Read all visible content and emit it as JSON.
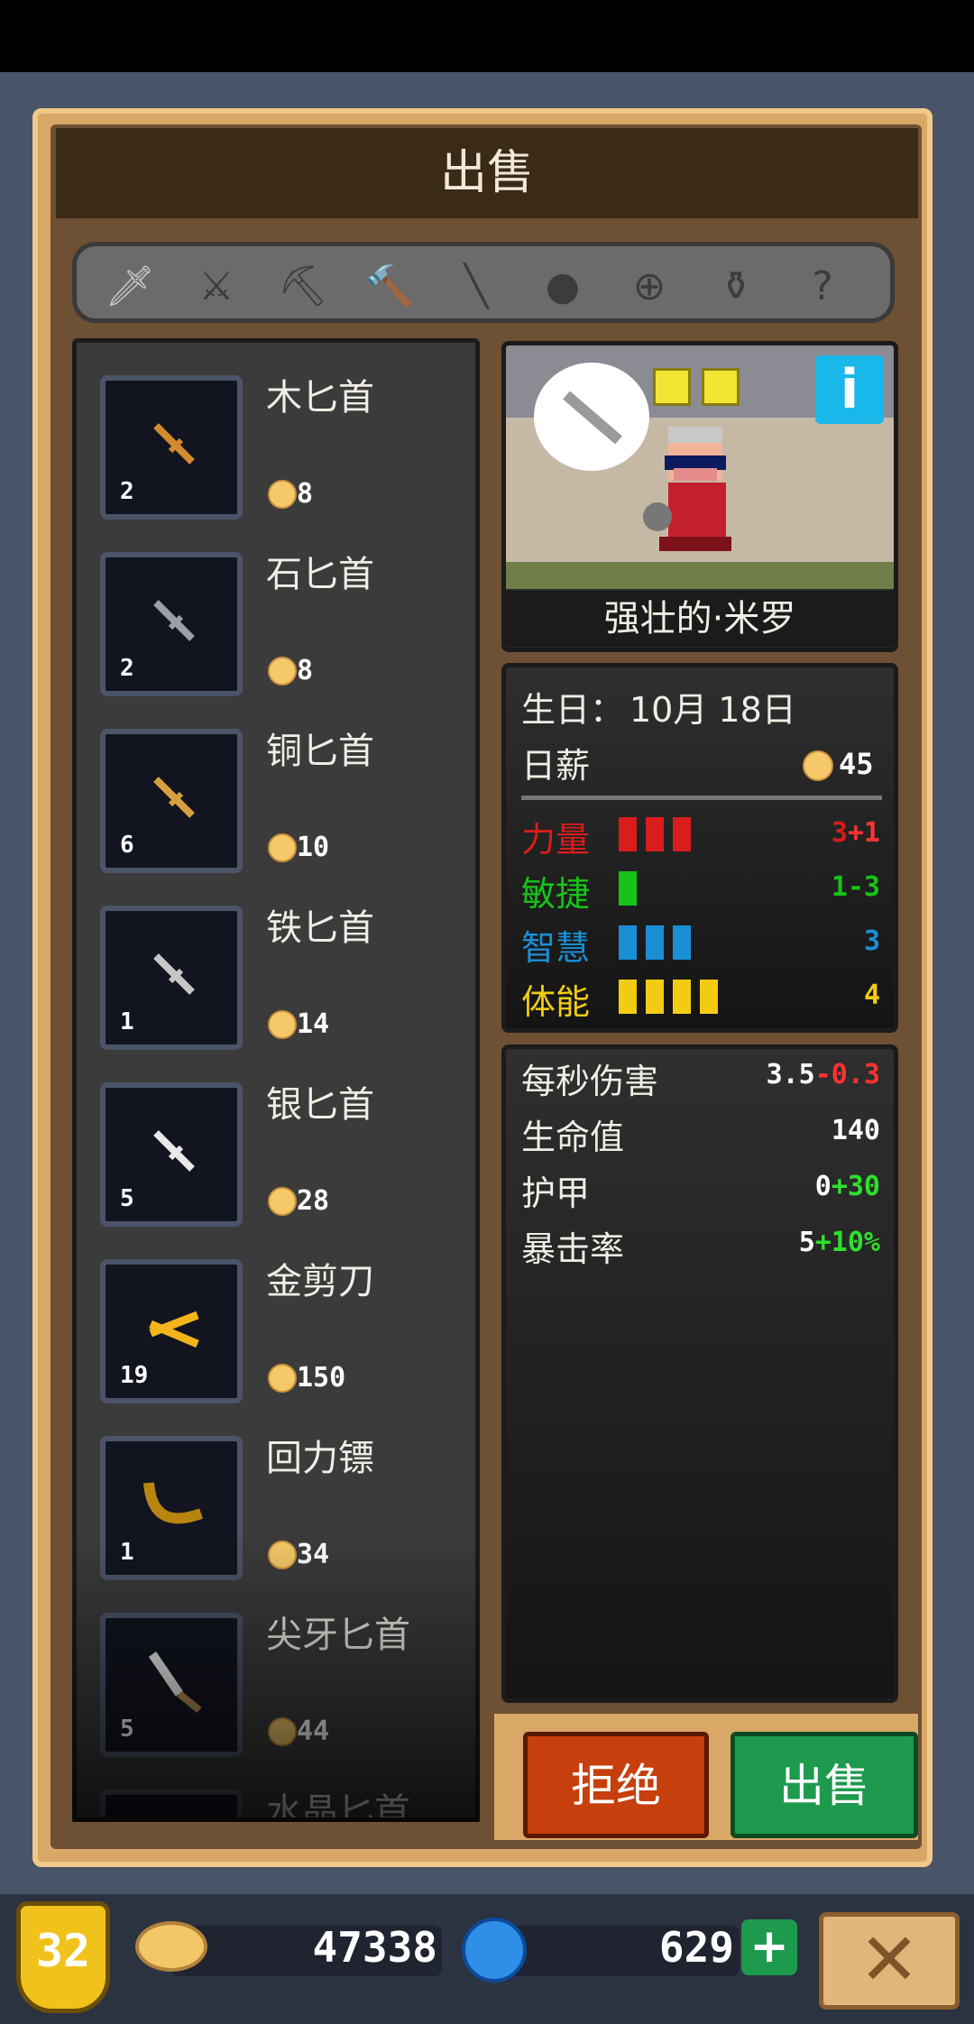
{
  "title": "出售",
  "categories": [
    {
      "icon": "dagger-icon"
    },
    {
      "icon": "sword-icon"
    },
    {
      "icon": "axe-icon"
    },
    {
      "icon": "hammer-icon"
    },
    {
      "icon": "spear-icon"
    },
    {
      "icon": "mace-icon"
    },
    {
      "icon": "bow-icon"
    },
    {
      "icon": "pot-icon"
    },
    {
      "icon": "question-icon"
    }
  ],
  "items": [
    {
      "name": "木匕首",
      "qty": "2",
      "price": "8",
      "icon": "dagger-icon",
      "color": "#d48a2e"
    },
    {
      "name": "石匕首",
      "qty": "2",
      "price": "8",
      "icon": "dagger-icon",
      "color": "#9aa0a8"
    },
    {
      "name": "铜匕首",
      "qty": "6",
      "price": "10",
      "icon": "dagger-icon",
      "color": "#d7a03f"
    },
    {
      "name": "铁匕首",
      "qty": "1",
      "price": "14",
      "icon": "dagger-icon",
      "color": "#c7c7c7"
    },
    {
      "name": "银匕首",
      "qty": "5",
      "price": "28",
      "icon": "dagger-icon",
      "color": "#e8e8e8"
    },
    {
      "name": "金剪刀",
      "qty": "19",
      "price": "150",
      "icon": "scissors-icon",
      "color": "#f2b418"
    },
    {
      "name": "回力镖",
      "qty": "1",
      "price": "34",
      "icon": "boomerang-icon",
      "color": "#b88510"
    },
    {
      "name": "尖牙匕首",
      "qty": "5",
      "price": "44",
      "icon": "fang-dagger-icon",
      "color": "#efefef"
    },
    {
      "name": "水晶匕首",
      "qty": "",
      "price": "",
      "icon": "dagger-icon",
      "color": "#8fd0ff"
    }
  ],
  "hero": {
    "name": "强壮的·米罗"
  },
  "info_label": "i",
  "stats": {
    "birthday_label": "生日：",
    "birthday_value": "10月 18日",
    "salary_label": "日薪",
    "salary_value": "45",
    "attributes": [
      {
        "label": "力量",
        "color": "#d91c1c",
        "pips": 3,
        "base": "3",
        "bonus": "+1",
        "bonus_color": "#ff3333"
      },
      {
        "label": "敏捷",
        "color": "#16c416",
        "pips": 1,
        "base": "1",
        "bonus": "-3",
        "bonus_color": "#16c416"
      },
      {
        "label": "智慧",
        "color": "#1a8fd6",
        "pips": 3,
        "base": "3",
        "bonus": "",
        "bonus_color": "#1a8fd6"
      },
      {
        "label": "体能",
        "color": "#f2cc12",
        "pips": 4,
        "base": "4",
        "bonus": "",
        "bonus_color": "#f2cc12"
      }
    ]
  },
  "combat": [
    {
      "label": "每秒伤害",
      "base": "3.5",
      "mod": "-0.3",
      "mod_color": "#ff3333"
    },
    {
      "label": "生命值",
      "base": "140",
      "mod": "",
      "mod_color": "#ffffff"
    },
    {
      "label": "护甲",
      "base": "0",
      "mod": "+30",
      "mod_color": "#2de02d"
    },
    {
      "label": "暴击率",
      "base": "5",
      "mod": "+10%",
      "mod_color": "#2de02d"
    }
  ],
  "buttons": {
    "reject": "拒绝",
    "sell": "出售"
  },
  "footer": {
    "level": "32",
    "gold": "47338",
    "gems": "629",
    "plus": "+",
    "close": "✕"
  }
}
